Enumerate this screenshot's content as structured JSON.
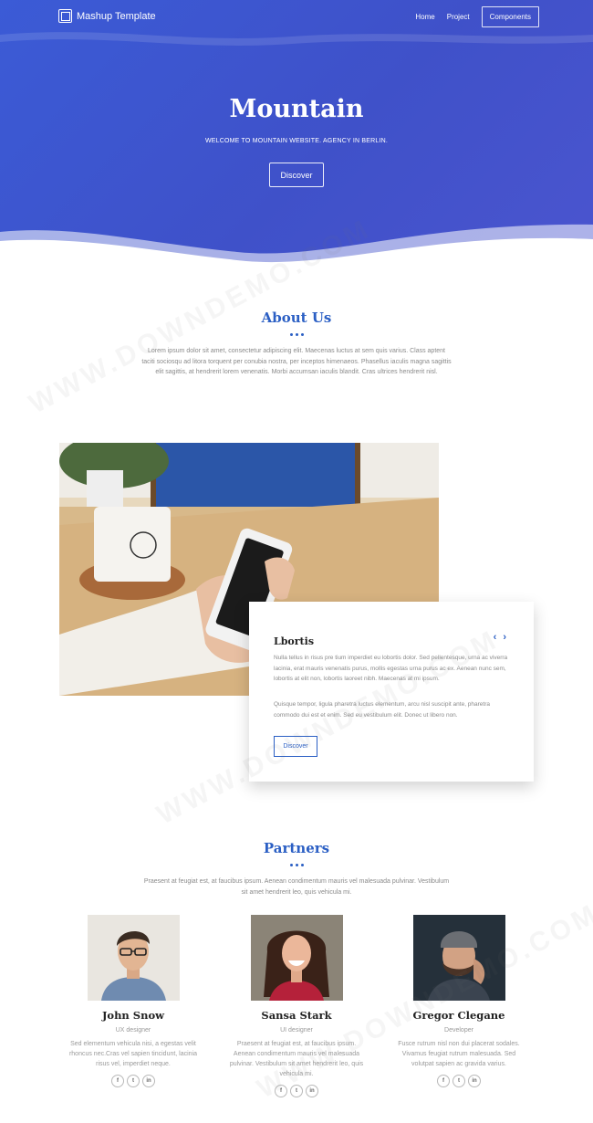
{
  "nav": {
    "brand": "Mashup Template",
    "links": [
      "Home",
      "Project"
    ],
    "cta": "Components"
  },
  "hero": {
    "title": "Mountain",
    "subtitle": "WELCOME TO MOUNTAIN WEBSITE. AGENCY IN BERLIN.",
    "button": "Discover"
  },
  "about": {
    "title": "About Us",
    "text": "Lorem ipsum dolor sit amet, consectetur adipiscing elit. Maecenas luctus at sem quis varius. Class aptent taciti sociosqu ad litora torquent per conubia nostra, per inceptos himenaeos. Phasellus iaculis magna sagittis elit sagittis, at hendrerit lorem venenatis. Morbi accumsan iaculis blandit. Cras ultrices hendrerit nisl."
  },
  "card": {
    "title": "Lbortis",
    "para1": "Nulla tellus in risus pre tium imperdiet eu lobortis dolor. Sed pellentesque, urna ac viverra lacinia, erat mauris venenatis purus, mollis egestas urna purus ac ex. Aenean nunc sem, lobortis at elit non, lobortis laoreet nibh. Maecenas at mi ipsum.",
    "para2": "Quisque tempor, ligula pharetra luctus elementum, arcu nisl suscipit ante, pharetra commodo dui est et enim. Sed eu vestibulum elit. Donec ut libero non.",
    "button": "Discover",
    "prev_icon": "chevron-left-icon",
    "next_icon": "chevron-right-icon"
  },
  "partners": {
    "title": "Partners",
    "text": "Praesent at feugiat est, at faucibus ipsum. Aenean condimentum mauris vel malesuada pulvinar. Vestibulum sit amet hendrerit leo, quis vehicula mi.",
    "members": [
      {
        "name": "John Snow",
        "role": "UX designer",
        "desc": "Sed elementum vehicula nisi, a egestas velit rhoncus nec.Cras vel sapien tincidunt, lacinia risus vel, imperdiet neque."
      },
      {
        "name": "Sansa Stark",
        "role": "UI designer",
        "desc": "Praesent at feugiat est, at faucibus ipsum. Aenean condimentum mauris vel malesuada pulvinar. Vestibulum sit amet hendrerit leo, quis vehicula mi."
      },
      {
        "name": "Gregor Clegane",
        "role": "Developer",
        "desc": "Fusce rutrum nisl non dui placerat sodales. Vivamus feugiat rutrum malesuada. Sed volutpat sapien ac gravida varius."
      }
    ],
    "social_labels": [
      "f",
      "t",
      "in"
    ]
  },
  "watermark": "WWW.DOWNDEMO.COM",
  "colors": {
    "accent": "#2b5fc4",
    "hero": "#3f51c9"
  }
}
